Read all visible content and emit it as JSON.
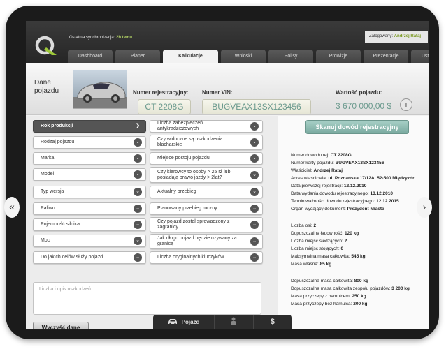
{
  "header": {
    "sync_label": "Ostatnia synchronizacja:",
    "sync_value": "2h temu",
    "user_label": "Zalogowany:",
    "user_name": "Andrzej Rataj"
  },
  "tabs": [
    "Dashboard",
    "Planer",
    "Kalkulacje",
    "Wnioski",
    "Polisy",
    "Prowizje",
    "Prezentacje",
    "Ustawienia"
  ],
  "vehicle": {
    "section_title": "Dane pojazdu",
    "reg_label": "Numer rejestracyjny:",
    "reg_value": "CT 2208G",
    "vin_label": "Numer VIN:",
    "vin_value": "BUGVEAX13SX123456",
    "value_label": "Wartość pojazdu:",
    "value_value": "3 670 000,00 $",
    "add_symbol": "+"
  },
  "fields": {
    "left": [
      "Rok produkcji",
      "Rodzaj pojazdu",
      "Marka",
      "Model",
      "Typ wersja",
      "Paliwo",
      "Pojemność silnika",
      "Moc",
      "Do jakich celów służy pojazd"
    ],
    "right": [
      "Liczba zabezpieczeń antykradzieżowych",
      "Czy widoczne są uszkodzenia blacharskie",
      "Miejsce postoju pojazdu",
      "Czy kierowcy to osoby > 25 rż lub posiadają prawo jazdy > 2lat?",
      "Aktualny przebieg",
      "Planowany przebieg roczny",
      "Czy pojazd został sprowadzony z zagranicy",
      "Jak długo pojazd będzie używany za granicą",
      "Liczba oryginalnych kluczyków"
    ]
  },
  "notes_placeholder": "Liczba i opis uszkodzeń ...",
  "clear_button": "Wyczyść dane",
  "scan_button": "Skanuj dowód rejestracyjny",
  "document_info": [
    {
      "label": "Numer dowodu rej:",
      "value": "CT 2208G"
    },
    {
      "label": "Numer karty pojazdu:",
      "value": "BUGVEAX13SX123456"
    },
    {
      "label": "Właściciel:",
      "value": "Andrzej Rataj"
    },
    {
      "label": "Adres właściciela:",
      "value": "ul. Poznańska 17/12A, 52-500 Międzyzdr."
    },
    {
      "label": "Data pierwszej rejestracji:",
      "value": "12.12.2010"
    },
    {
      "label": "Data wydania dowodu rejestracyjnego:",
      "value": "13.12.2010"
    },
    {
      "label": "Termin ważności dowodu rejestracyjnego:",
      "value": "12.12.2015"
    },
    {
      "label": "Organ wydający dokument:",
      "value": "Prezydent Miasta"
    }
  ],
  "axle_info": [
    {
      "label": "Liczba osi:",
      "value": "2"
    },
    {
      "label": "Dopuszczalna ładowność:",
      "value": "120 kg"
    },
    {
      "label": "Liczba miejsc siedzących:",
      "value": "2"
    },
    {
      "label": "Liczba miejsc stojących:",
      "value": "0"
    },
    {
      "label": "Maksymalna masa całkowita:",
      "value": "545 kg"
    },
    {
      "label": "Masa własna:",
      "value": "85 kg"
    }
  ],
  "mass_info": [
    {
      "label": "Dopuszczalna masa całkowita:",
      "value": "800 kg"
    },
    {
      "label": "Dopuszczalna masa całkowita zespołu pojazdów:",
      "value": "3 200 kg"
    },
    {
      "label": "Masa przyczepy z hamulcem:",
      "value": "250 kg"
    },
    {
      "label": "Masa przyczepy bez hamulca:",
      "value": "200 kg"
    }
  ],
  "bottom_nav": {
    "vehicle_label": "Pojazd",
    "vehicle_icon": "car-icon",
    "person_icon": "person-icon",
    "money_icon": "dollar-icon"
  },
  "edge_arrows": {
    "left": "«",
    "right": "›"
  }
}
